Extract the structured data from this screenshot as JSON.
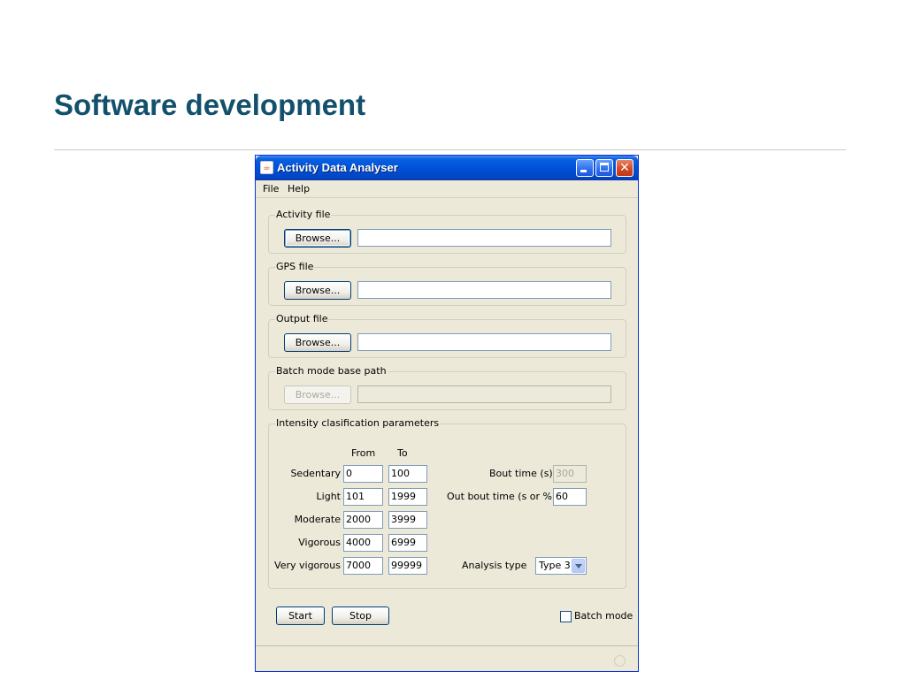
{
  "slide": {
    "title": "Software development"
  },
  "window": {
    "title": "Activity Data Analyser",
    "icon": "java-cup-icon",
    "controls": [
      "minimize",
      "maximize",
      "close"
    ]
  },
  "menu": {
    "file": "File",
    "help": "Help"
  },
  "activity_file": {
    "label": "Activity file",
    "browse": "Browse...",
    "path": ""
  },
  "gps_file": {
    "label": "GPS file",
    "browse": "Browse...",
    "path": ""
  },
  "output_file": {
    "label": "Output file",
    "browse": "Browse...",
    "path": ""
  },
  "batch_path": {
    "label": "Batch mode base path",
    "browse": "Browse...",
    "path": "",
    "disabled": true
  },
  "intensity": {
    "label": "Intensity clasification parameters",
    "col_from": "From",
    "col_to": "To",
    "rows": [
      {
        "label": "Sedentary",
        "from": "0",
        "to": "100"
      },
      {
        "label": "Light",
        "from": "101",
        "to": "1999"
      },
      {
        "label": "Moderate",
        "from": "2000",
        "to": "3999"
      },
      {
        "label": "Vigorous",
        "from": "4000",
        "to": "6999"
      },
      {
        "label": "Very vigorous",
        "from": "7000",
        "to": "99999"
      }
    ],
    "bout_time_label": "Bout time (s)",
    "bout_time_value": "300",
    "out_bout_label": "Out bout time (s or %)",
    "out_bout_value": "60",
    "analysis_type_label": "Analysis type",
    "analysis_type_value": "Type 3"
  },
  "actions": {
    "start": "Start",
    "stop": "Stop",
    "batch_mode": "Batch mode",
    "batch_checked": false
  },
  "colors": {
    "title": "#13506b",
    "titlebar": "#0052d6",
    "window_bg": "#ece9d8"
  }
}
